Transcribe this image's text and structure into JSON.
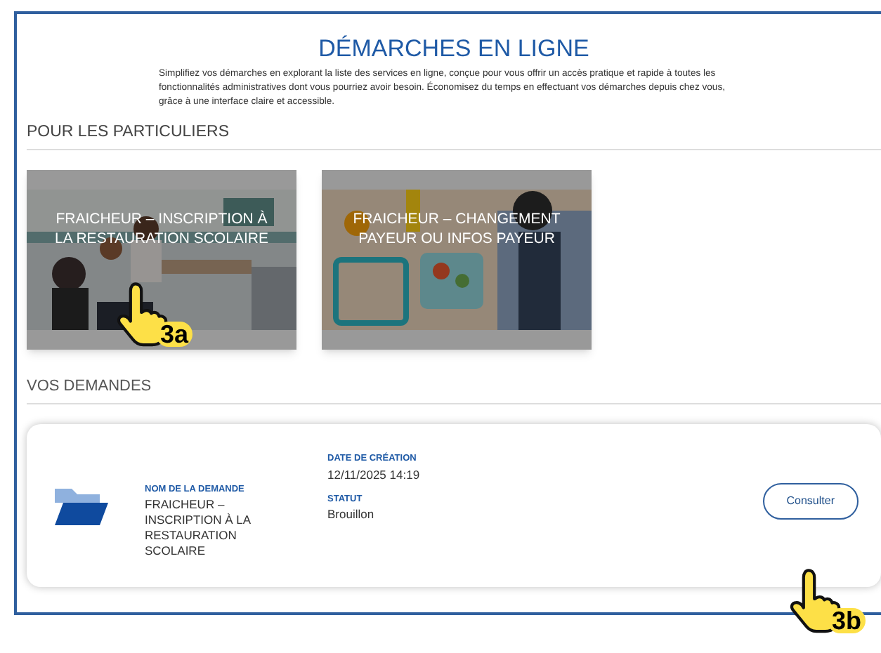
{
  "title": "DÉMARCHES EN LIGNE",
  "intro": "Simplifiez vos démarches en explorant la liste des services en ligne, conçue pour vous offrir un accès pratique et rapide à toutes les fonctionnalités administratives dont vous pourriez avoir besoin. Économisez du temps en effectuant vos démarches depuis chez vous, grâce à une interface claire et accessible.",
  "services_heading": "POUR LES PARTICULIERS",
  "services": [
    {
      "label": "FRAICHEUR – INSCRIPTION À LA RESTAURATION SCOLAIRE",
      "kind": "picture"
    },
    {
      "label": "FRAICHEUR – CHANGEMENT PAYEUR OU INFOS PAYEUR",
      "kind": "picture"
    }
  ],
  "requests_heading": "VOS DEMANDES",
  "requests": [
    {
      "name_label": "NOM DE LA DEMANDE",
      "name": "FRAICHEUR – INSCRIPTION À LA RESTAURATION SCOLAIRE",
      "date_label": "DATE DE CRÉATION",
      "date": "12/11/2025 14:19",
      "status_label": "STATUT",
      "status": "Brouillon",
      "action": "Consulter"
    }
  ],
  "callouts": [
    {
      "label": "3a"
    },
    {
      "label": "3b"
    }
  ]
}
